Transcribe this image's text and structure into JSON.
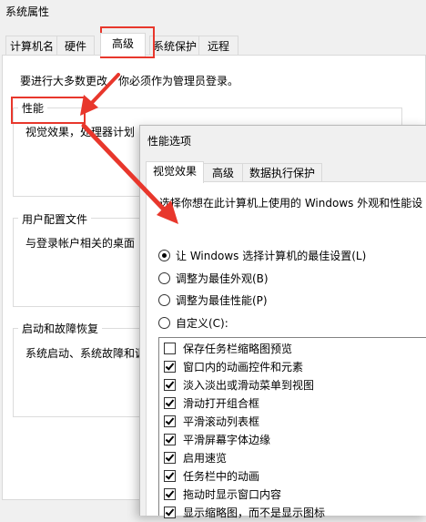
{
  "outer": {
    "title": "系统属性",
    "tabs": [
      "计算机名",
      "硬件",
      "高级",
      "系统保护",
      "远程"
    ],
    "notice": "要进行大多数更改，你必须作为管理员登录。",
    "performance": {
      "label": "性能",
      "text": "视觉效果，处理器计划"
    },
    "profile": {
      "label": "用户配置文件",
      "text": "与登录帐户相关的桌面"
    },
    "startup": {
      "label": "启动和故障恢复",
      "text": "系统启动、系统故障和调"
    }
  },
  "inner": {
    "title": "性能选项",
    "tabs": [
      "视觉效果",
      "高级",
      "数据执行保护"
    ],
    "prompt": "选择你想在此计算机上使用的 Windows 外观和性能设",
    "radios": [
      {
        "label": "让 Windows 选择计算机的最佳设置(L)",
        "selected": true
      },
      {
        "label": "调整为最佳外观(B)",
        "selected": false
      },
      {
        "label": "调整为最佳性能(P)",
        "selected": false
      },
      {
        "label": "自定义(C):",
        "selected": false
      }
    ],
    "options": [
      {
        "label": "保存任务栏缩略图预览",
        "checked": false
      },
      {
        "label": "窗口内的动画控件和元素",
        "checked": true
      },
      {
        "label": "淡入淡出或滑动菜单到视图",
        "checked": true
      },
      {
        "label": "滑动打开组合框",
        "checked": true
      },
      {
        "label": "平滑滚动列表框",
        "checked": true
      },
      {
        "label": "平滑屏幕字体边缘",
        "checked": true
      },
      {
        "label": "启用速览",
        "checked": true
      },
      {
        "label": "任务栏中的动画",
        "checked": true
      },
      {
        "label": "拖动时显示窗口内容",
        "checked": true
      },
      {
        "label": "显示缩略图，而不是显示图标",
        "checked": true
      }
    ]
  },
  "colors": {
    "annotation": "#e8372c"
  }
}
